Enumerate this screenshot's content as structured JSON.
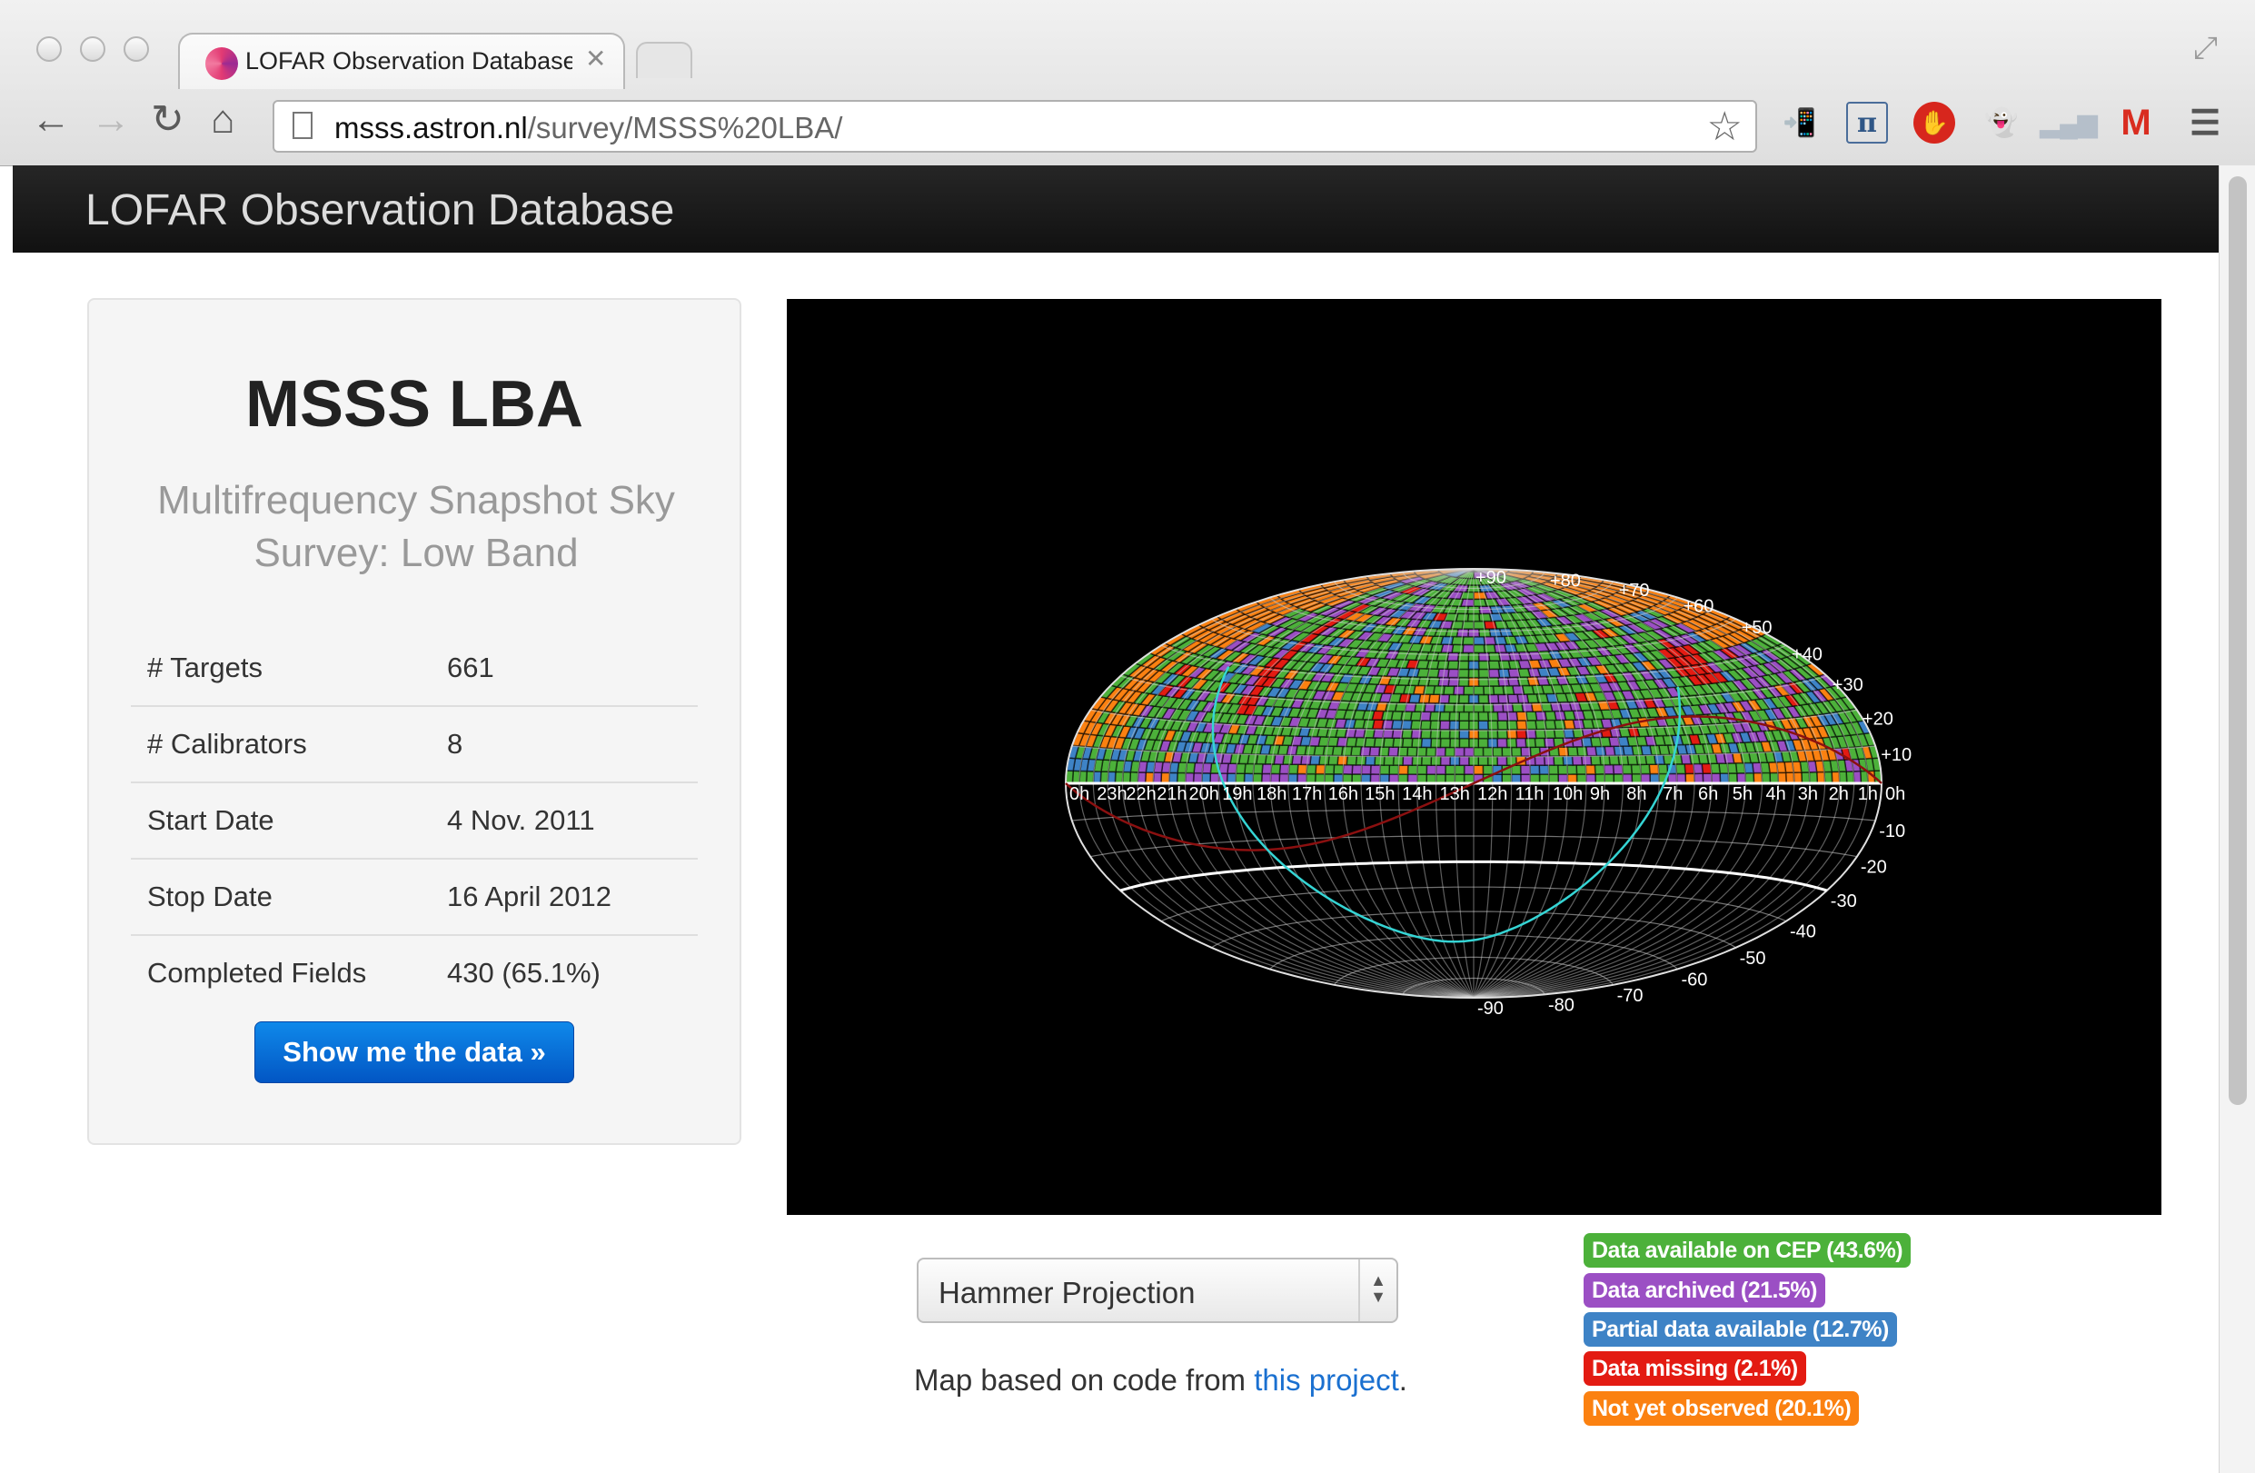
{
  "browser": {
    "tab_title": "LOFAR Observation Database",
    "url_host": "msss.astron.nl",
    "url_path": "/survey/MSSS%20LBA/",
    "icons": [
      "back-icon",
      "forward-icon",
      "reload-icon",
      "home-icon",
      "star-icon",
      "menu-icon",
      "gmail-icon"
    ]
  },
  "header": {
    "brand": "LOFAR Observation Database"
  },
  "survey": {
    "title": "MSSS LBA",
    "subtitle": "Multifrequency Snapshot Sky Survey: Low Band",
    "stats": [
      {
        "label": "# Targets",
        "value": "661"
      },
      {
        "label": "# Calibrators",
        "value": "8"
      },
      {
        "label": "Start Date",
        "value": "4 Nov. 2011"
      },
      {
        "label": "Stop Date",
        "value": "16 April 2012"
      },
      {
        "label": "Completed Fields",
        "value": "430 (65.1%)"
      }
    ],
    "button": "Show me the data »"
  },
  "map": {
    "ra_labels": [
      "0h",
      "23h",
      "22h",
      "21h",
      "20h",
      "19h",
      "18h",
      "17h",
      "16h",
      "15h",
      "14h",
      "13h",
      "12h",
      "11h",
      "10h",
      "9h",
      "8h",
      "7h",
      "6h",
      "5h",
      "4h",
      "3h",
      "2h",
      "1h",
      "0h"
    ],
    "dec_labels_north": [
      "+90",
      "+80",
      "+70",
      "+60",
      "+50",
      "+40",
      "+30",
      "+20",
      "+10"
    ],
    "dec_labels_south": [
      "-10",
      "-20",
      "-30",
      "-40",
      "-50",
      "-60",
      "-70",
      "-80",
      "-90"
    ],
    "colors": {
      "cep": "#4cb13a",
      "archived": "#9b4fc4",
      "partial": "#3e83c6",
      "missing": "#e31b12",
      "not_observed": "#fb8111"
    }
  },
  "projection": {
    "selected": "Hammer Projection"
  },
  "credit": {
    "prefix": "Map based on code from ",
    "link": "this project",
    "suffix": "."
  },
  "legend": [
    {
      "label": "Data available on CEP (43.6%)",
      "color": "#4cb13a"
    },
    {
      "label": "Data archived (21.5%)",
      "color": "#9b4fc4"
    },
    {
      "label": "Partial data available (12.7%)",
      "color": "#3e83c6"
    },
    {
      "label": "Data missing (2.1%)",
      "color": "#e31b12"
    },
    {
      "label": "Not yet observed (20.1%)",
      "color": "#fb8111"
    }
  ]
}
